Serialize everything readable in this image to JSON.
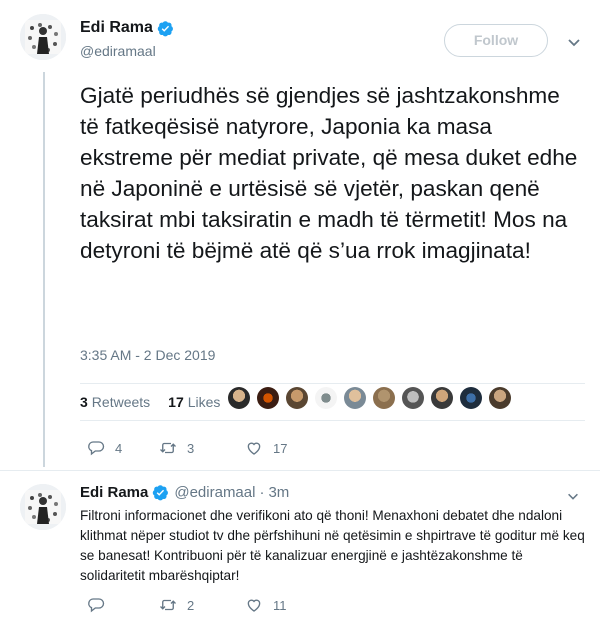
{
  "main_tweet": {
    "display_name": "Edi Rama",
    "handle": "@ediramaal",
    "follow_label": "Follow",
    "text": "Gjatë periudhës së gjendjes së jashtzakonshme të fatkeqësisë natyrore, Japonia ka masa ekstreme për mediat private, që mesa duket edhe në Japoninë e urtësisë së vjetër, paskan qenë taksirat mbi taksiratin e madh të tërmetit! Mos na detyroni të bëjmë atë që s’ua rrok imagjinata!",
    "timestamp": "3:35 AM - 2 Dec 2019",
    "retweets_count": "3",
    "retweets_label": "Retweets",
    "likes_count": "17",
    "likes_label": "Likes",
    "actions": {
      "reply_count": "4",
      "retweet_count": "3",
      "like_count": "17"
    }
  },
  "reply_tweet": {
    "display_name": "Edi Rama",
    "handle": "@ediramaal",
    "separator": "·",
    "time": "3m",
    "text": "Filtroni informacionet dhe verifikoni ato që thoni! Menaxhoni debatet dhe ndaloni klithmat nëper studiot tv dhe përfshihuni në qetësimin e shpirtrave të goditur më keq se banesat! Kontribuoni për të kanalizuar energjinë e jashtëzakonshme të solidaritetit mbarëshqiptar!",
    "actions": {
      "reply_count": "",
      "retweet_count": "2",
      "like_count": "11"
    }
  },
  "colors": {
    "verified": "#1da1f2",
    "secondary_text": "#657786",
    "border": "#e6ecf0",
    "thread_line": "#ccd6dd"
  }
}
